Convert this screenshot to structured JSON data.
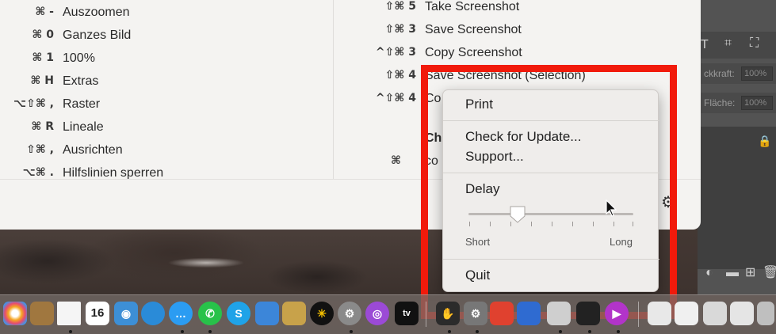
{
  "cheatsheet": {
    "left_column": [
      {
        "keys": "⌘ -",
        "label": "Auszoomen"
      },
      {
        "keys": "⌘ 0",
        "label": "Ganzes Bild"
      },
      {
        "keys": "⌘ 1",
        "label": "100%"
      },
      {
        "keys": "⌘ H",
        "label": "Extras"
      },
      {
        "keys": "⌥⇧⌘ ,",
        "label": "Raster"
      },
      {
        "keys": "⌘ R",
        "label": "Lineale"
      },
      {
        "keys": "⇧⌘ ,",
        "label": "Ausrichten"
      },
      {
        "keys": "⌥⌘ .",
        "label": "Hilfslinien sperren"
      }
    ],
    "right_column": [
      {
        "keys": "⇧⌘ 5",
        "label": "Take Screenshot"
      },
      {
        "keys": "⇧⌘ 3",
        "label": "Save Screenshot"
      },
      {
        "keys": "^⇧⌘ 3",
        "label": "Copy Screenshot"
      },
      {
        "keys": "⇧⌘ 4",
        "label": "Save Screenshot (Selection)"
      },
      {
        "keys": "^⇧⌘ 4",
        "label": "Co"
      },
      {
        "keys": "",
        "label": "Ch"
      },
      {
        "keys": "⌘",
        "label": "co"
      }
    ]
  },
  "context_menu": {
    "print": "Print",
    "check_update": "Check for Update...",
    "support": "Support...",
    "delay_label": "Delay",
    "slider_min_label": "Short",
    "slider_max_label": "Long",
    "delay_value": 0.3,
    "quit": "Quit"
  },
  "photoshop_panel": {
    "opacity_label": "ckkraft:",
    "opacity_value": "100%",
    "fill_label": "Fläche:",
    "fill_value": "100%"
  },
  "dock": {
    "icons": [
      "photos-icon",
      "contacts-icon",
      "screenshot-icon",
      "calendar-icon",
      "camera-icon",
      "tweetbot-icon",
      "messages-icon",
      "whatsapp-icon",
      "skype-icon",
      "keynote-icon",
      "transmit-icon",
      "clock-icon",
      "system-preferences-icon",
      "podcasts-icon",
      "apple-tv-icon",
      "cheatsheet-icon",
      "gear-app-icon",
      "office-icon",
      "pages-icon",
      "preview-icon",
      "terminal-icon",
      "video-app-icon",
      "document-icon",
      "numbers-icon",
      "file-icon",
      "archive-icon",
      "trash-icon"
    ],
    "calendar_day": "16",
    "appletv_label": "tv"
  },
  "colors": {
    "highlight": "#f11a0b",
    "menu_bg": "#efedeb",
    "window_bg": "#f4f3f1"
  }
}
